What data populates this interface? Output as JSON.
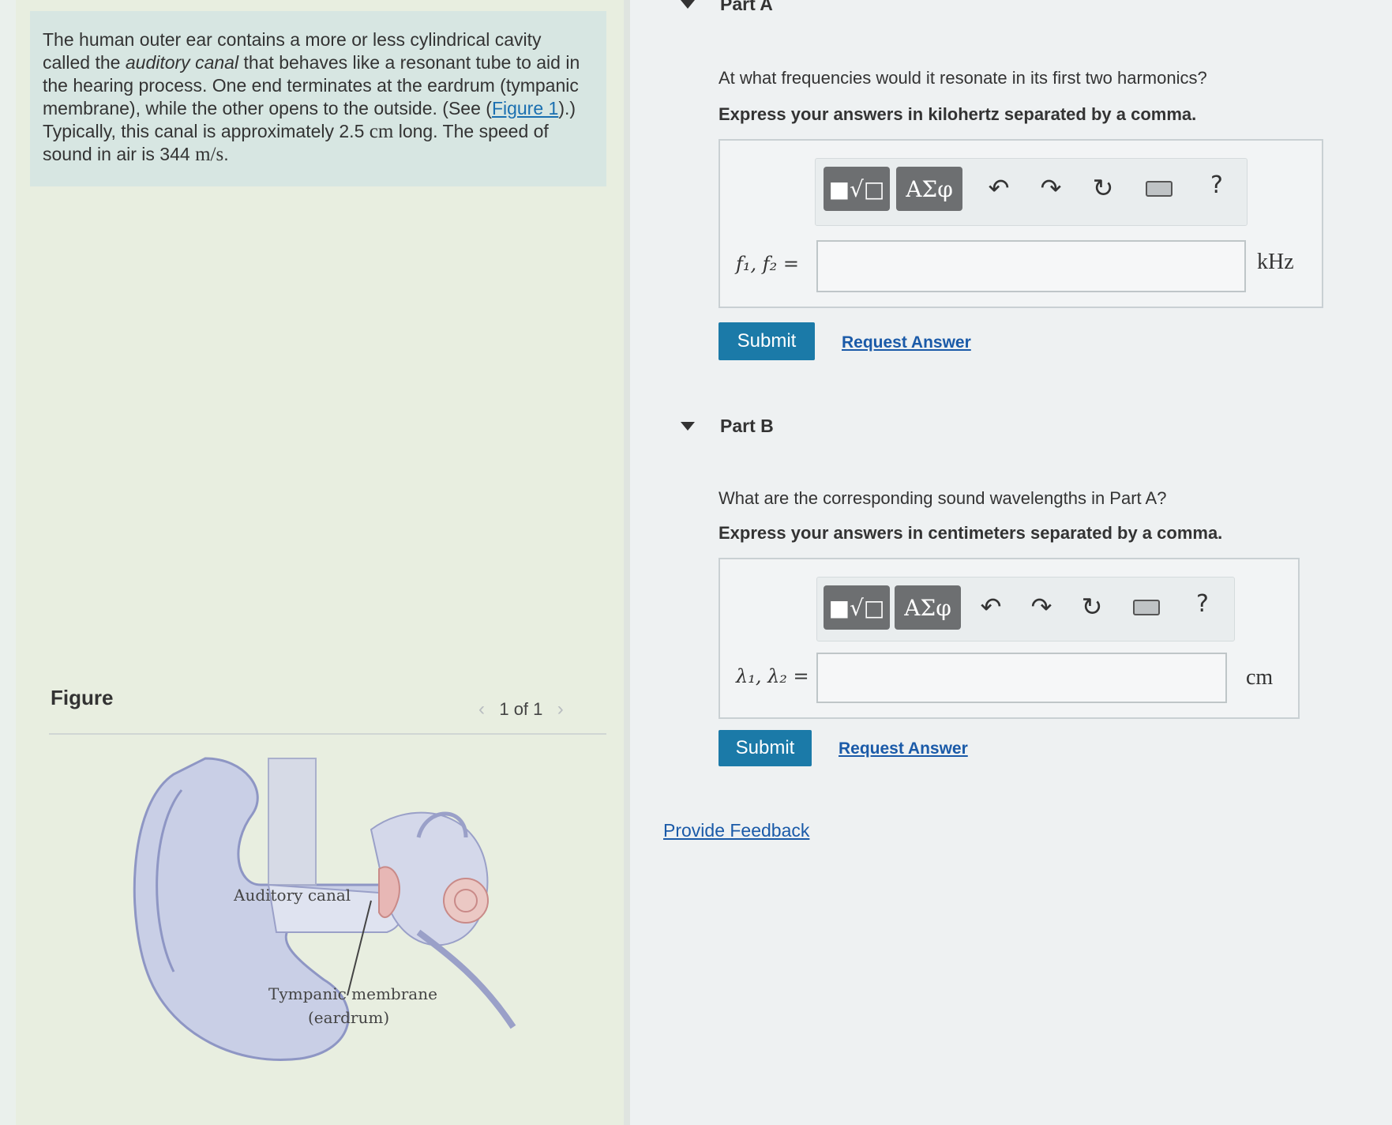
{
  "problem": {
    "text_before_em": "The human outer ear contains a more or less cylindrical cavity called the ",
    "em_text": "auditory canal",
    "text_after_em": " that behaves like a resonant tube to aid in the hearing process. One end terminates at the eardrum (tympanic membrane), while the other opens to the outside. (See (",
    "figure_link": "Figure 1",
    "text_after_link": ").) Typically, this canal is approximately 2.5 ",
    "length_unit": "cm",
    "text_mid": " long. The speed of sound in air is 344 ",
    "speed_unit": "m/s",
    "text_end": "."
  },
  "figure": {
    "label": "Figure",
    "nav_prev": "‹",
    "page_indicator": "1 of 1",
    "nav_next": "›",
    "caption_canal": "Auditory canal",
    "caption_membrane": "Tympanic membrane",
    "caption_eardrum": "(eardrum)"
  },
  "partA": {
    "title": "Part A",
    "question": "At what frequencies would it resonate in its first two harmonics?",
    "instruction": "Express your answers in kilohertz separated by a comma.",
    "var_label": "f₁, f₂ =",
    "unit": "kHz",
    "submit": "Submit",
    "request": "Request Answer"
  },
  "partB": {
    "title": "Part B",
    "question": "What are the corresponding sound wavelengths in Part A?",
    "instruction": "Express your answers in centimeters separated by a comma.",
    "var_label": "λ₁, λ₂ =",
    "unit": "cm",
    "submit": "Submit",
    "request": "Request Answer"
  },
  "toolbar": {
    "templates": "■√□",
    "greek": "ΑΣφ",
    "undo": "↶",
    "redo": "↷",
    "reset": "↻",
    "help": "?"
  },
  "feedback": "Provide Feedback"
}
